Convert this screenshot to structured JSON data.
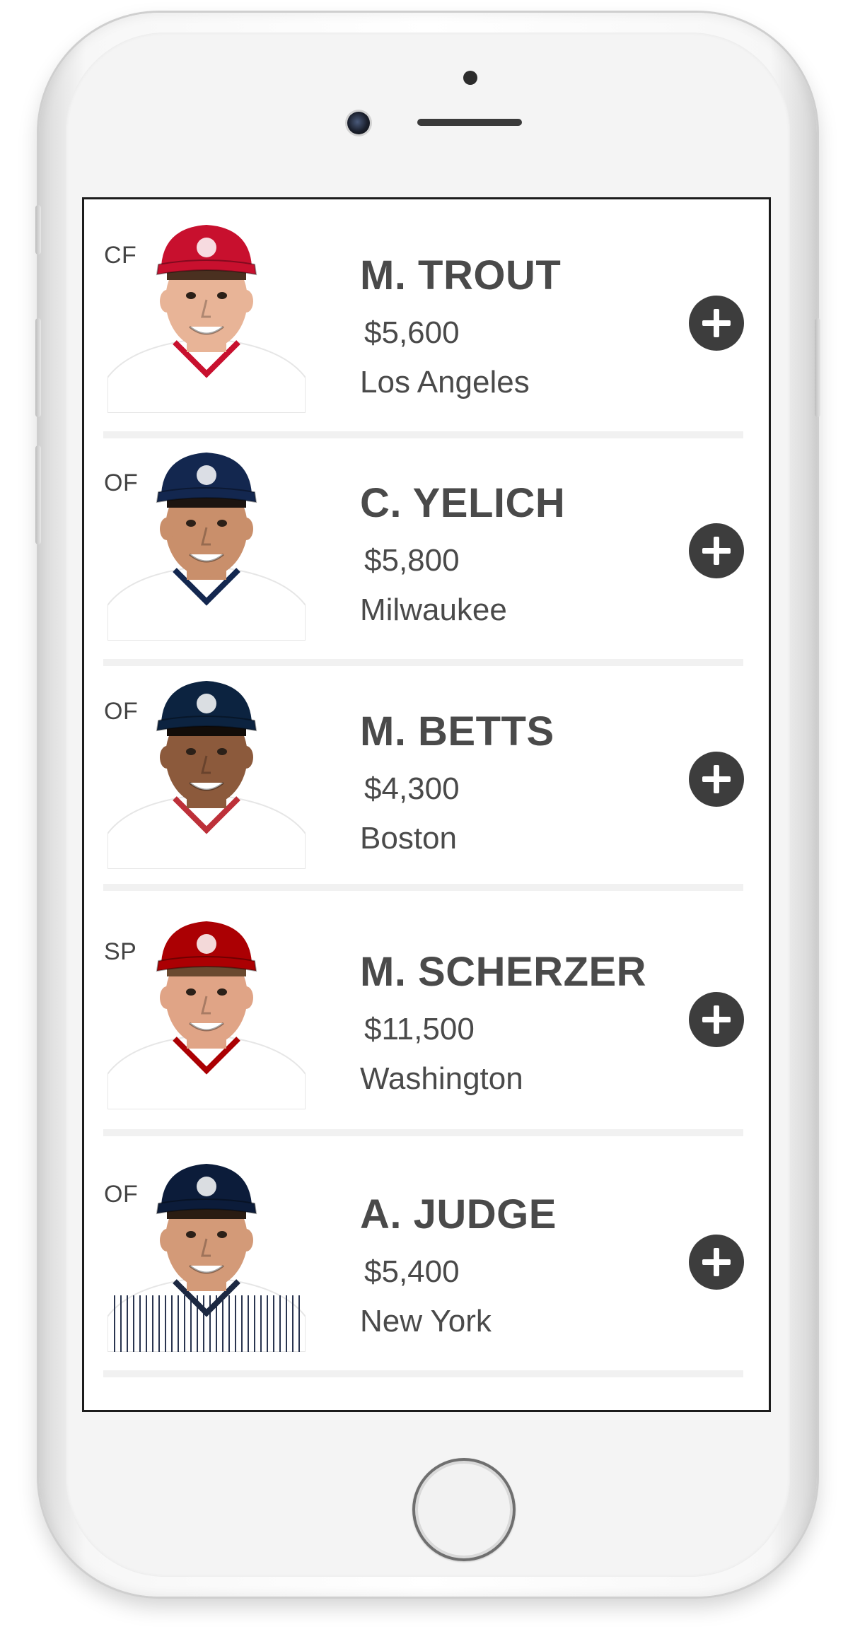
{
  "players": [
    {
      "position": "CF",
      "name": "M. TROUT",
      "salary": "$5,600",
      "team": "Los Angeles",
      "cap_color": "#c8102e",
      "jersey_color": "#ffffff",
      "trim_color": "#c8102e"
    },
    {
      "position": "OF",
      "name": "C. YELICH",
      "salary": "$5,800",
      "team": "Milwaukee",
      "cap_color": "#13274f",
      "jersey_color": "#ffffff",
      "trim_color": "#13274f"
    },
    {
      "position": "OF",
      "name": "M. BETTS",
      "salary": "$4,300",
      "team": "Boston",
      "cap_color": "#0c2340",
      "jersey_color": "#ffffff",
      "trim_color": "#bd3039"
    },
    {
      "position": "SP",
      "name": "M. SCHERZER",
      "salary": "$11,500",
      "team": "Washington",
      "cap_color": "#ab0003",
      "jersey_color": "#ffffff",
      "trim_color": "#ab0003"
    },
    {
      "position": "OF",
      "name": "A. JUDGE",
      "salary": "$5,400",
      "team": "New York",
      "cap_color": "#0c1c3a",
      "jersey_color": "#ffffff",
      "trim_color": "#1c2841"
    }
  ],
  "icons": {
    "add": "plus-circle-icon"
  },
  "colors": {
    "text": "#4a4a4a",
    "add_button": "#3d3d3d",
    "divider": "#f1f1f1"
  }
}
